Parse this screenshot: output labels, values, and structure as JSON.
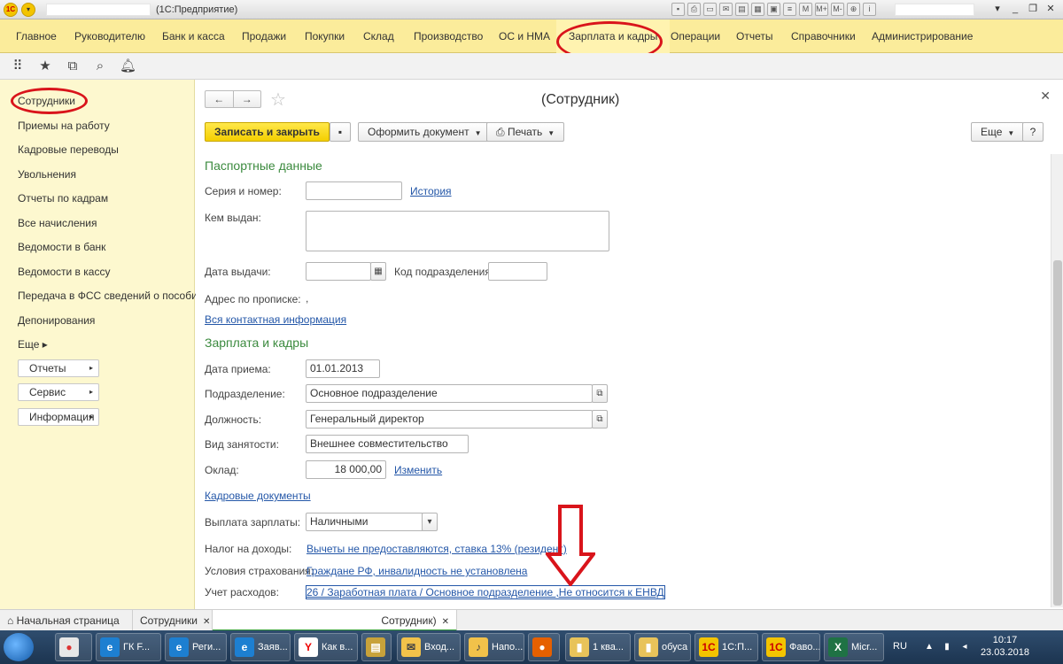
{
  "window": {
    "app_title": "(1С:Предприятие)",
    "logo": "1C",
    "toolbar_icons": [
      "save-icon",
      "print-icon",
      "preview-icon",
      "mail-icon",
      "clipboard-icon",
      "calendar-icon",
      "calculator-icon",
      "list-icon",
      "m-icon",
      "m-plus-icon",
      "m-minus-icon",
      "zoom-icon",
      "info-icon",
      "user-icon"
    ],
    "m_labels": [
      "M",
      "M+",
      "M-"
    ],
    "controls": [
      "▾",
      "_",
      "❐",
      "✕"
    ]
  },
  "sections": [
    {
      "label": "Главное"
    },
    {
      "label": "Руководителю"
    },
    {
      "label": "Банк и касса"
    },
    {
      "label": "Продажи"
    },
    {
      "label": "Покупки"
    },
    {
      "label": "Склад"
    },
    {
      "label": "Производство"
    },
    {
      "label": "ОС и НМА"
    },
    {
      "label": "Зарплата и кадры"
    },
    {
      "label": "Операции"
    },
    {
      "label": "Отчеты"
    },
    {
      "label": "Справочники"
    },
    {
      "label": "Администрирование"
    }
  ],
  "quickbar": [
    "apps-grid-icon",
    "favorites-star-icon",
    "history-icon",
    "search-icon",
    "bell-icon"
  ],
  "leftnav": {
    "items": [
      {
        "label": "Сотрудники"
      },
      {
        "label": "Приемы на работу"
      },
      {
        "label": "Кадровые переводы"
      },
      {
        "label": "Увольнения"
      },
      {
        "label": "Отчеты по кадрам"
      },
      {
        "label": "Все начисления"
      },
      {
        "label": "Ведомости в банк"
      },
      {
        "label": "Ведомости в кассу"
      },
      {
        "label": "Передача в ФСС сведений о пособиях"
      },
      {
        "label": "Депонирования"
      },
      {
        "label": "Еще ▸"
      }
    ],
    "buttons": [
      {
        "label": "Отчеты"
      },
      {
        "label": "Сервис"
      },
      {
        "label": "Информация"
      }
    ]
  },
  "form": {
    "title": "(Сотрудник)",
    "buttons": {
      "save_close": "Записать и закрыть",
      "create_doc": "Оформить документ",
      "print": "Печать",
      "more": "Еще",
      "help": "?"
    },
    "passport": {
      "section_title": "Паспортные данные",
      "series_label": "Серия и номер:",
      "series_value": "",
      "history_link": "История",
      "issued_by_label": "Кем выдан:",
      "issued_by_value": "",
      "issue_date_label": "Дата выдачи:",
      "issue_date_value": "",
      "dept_code_label": "Код подразделения",
      "dept_code_value": "",
      "address_label": "Адрес по прописке:",
      "address_value": ",",
      "contact_link": "Вся контактная информация"
    },
    "salary": {
      "section_title": "Зарплата и кадры",
      "hire_date_label": "Дата приема:",
      "hire_date_value": "01.01.2013",
      "department_label": "Подразделение:",
      "department_value": "Основное подразделение",
      "position_label": "Должность:",
      "position_value": "Генеральный директор",
      "employment_label": "Вид занятости:",
      "employment_value": "Внешнее совместительство",
      "salary_label": "Оклад:",
      "salary_value": "18 000,00",
      "change_link": "Изменить",
      "hr_docs_link": "Кадровые документы",
      "payment_label": "Выплата зарплаты:",
      "payment_value": "Наличными",
      "tax_label": "Налог на доходы:",
      "tax_link": "Вычеты не предоставляются, ставка 13% (резидент)",
      "insurance_label": "Условия страхования:",
      "insurance_link": "Граждане РФ, инвалидность не установлена",
      "expenses_label": "Учет расходов:",
      "expenses_link": "26 / Заработная плата / Основное подразделение ,Не относится к ЕНВД"
    }
  },
  "tabs": [
    {
      "label": "Начальная страница"
    },
    {
      "label": "Сотрудники"
    },
    {
      "label": "Сотрудник)"
    }
  ],
  "taskbar": {
    "tasks": [
      {
        "label": "ГК F..."
      },
      {
        "label": "Реги..."
      },
      {
        "label": "Заяв..."
      },
      {
        "label": "Как в..."
      },
      {
        "label": ""
      },
      {
        "label": "Вход..."
      },
      {
        "label": "Напо..."
      },
      {
        "label": ""
      },
      {
        "label": "1 ква..."
      },
      {
        "label": "обуса"
      },
      {
        "label": "1С:П..."
      },
      {
        "label": "Фаво..."
      },
      {
        "label": "Micr..."
      }
    ],
    "lang": "RU",
    "time": "10:17",
    "date": "23.03.2018"
  },
  "colors": {
    "section_bar": "#fbec9b",
    "left_nav": "#fdf8cf",
    "primary_button": "#f4cf00",
    "section_title": "#3b8a3e",
    "link": "#2457a8",
    "annotation_red": "#d9141b"
  }
}
